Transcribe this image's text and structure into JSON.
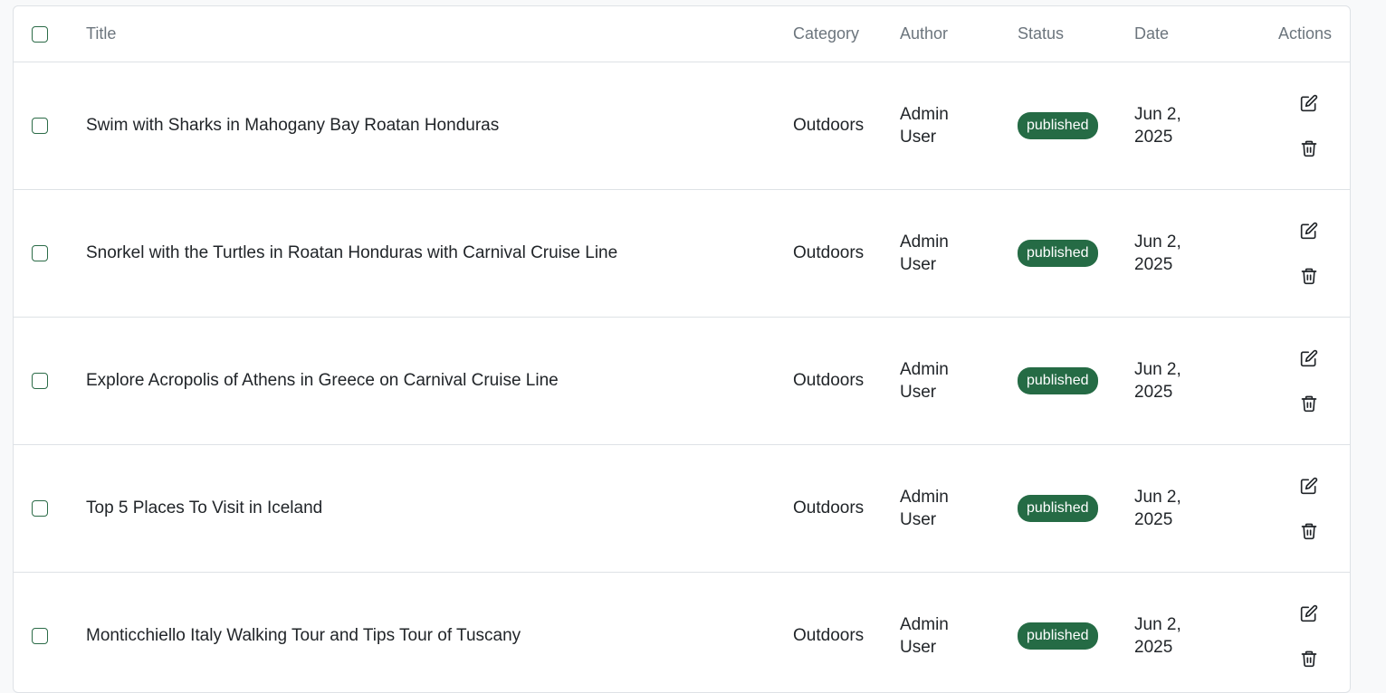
{
  "table": {
    "headers": {
      "title": "Title",
      "category": "Category",
      "author": "Author",
      "status": "Status",
      "date": "Date",
      "actions": "Actions"
    },
    "rows": [
      {
        "title": "Swim with Sharks in Mahogany Bay Roatan Honduras",
        "category": "Outdoors",
        "author": "Admin User",
        "status": "published",
        "date": "Jun 2, 2025"
      },
      {
        "title": "Snorkel with the Turtles in Roatan Honduras with Carnival Cruise Line",
        "category": "Outdoors",
        "author": "Admin User",
        "status": "published",
        "date": "Jun 2, 2025"
      },
      {
        "title": "Explore Acropolis of Athens in Greece on Carnival Cruise Line",
        "category": "Outdoors",
        "author": "Admin User",
        "status": "published",
        "date": "Jun 2, 2025"
      },
      {
        "title": "Top 5 Places To Visit in Iceland",
        "category": "Outdoors",
        "author": "Admin User",
        "status": "published",
        "date": "Jun 2, 2025"
      },
      {
        "title": "Monticchiello Italy Walking Tour and Tips Tour of Tuscany",
        "category": "Outdoors",
        "author": "Admin User",
        "status": "published",
        "date": "Jun 2, 2025"
      }
    ]
  },
  "icons": {
    "edit": "edit-icon",
    "delete": "trash-icon"
  },
  "colors": {
    "status_published": "#256b45",
    "checkbox_border": "#2b6b47"
  }
}
